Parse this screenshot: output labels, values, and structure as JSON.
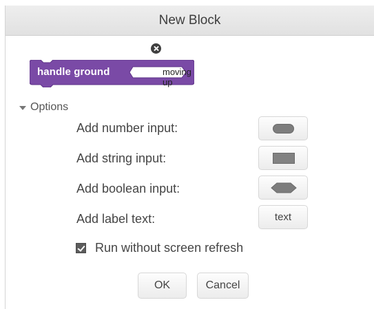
{
  "dialog": {
    "title": "New Block"
  },
  "block": {
    "label": "handle ground",
    "slot_text": "moving up",
    "color": "#7a4aa6",
    "border_color": "#5f3488",
    "delete_icon": "close-circle-icon"
  },
  "options": {
    "toggle_label": "Options",
    "rows": [
      {
        "label": "Add number input:",
        "button_icon": "rounded-pill-icon"
      },
      {
        "label": "Add string input:",
        "button_icon": "rectangle-icon"
      },
      {
        "label": "Add boolean input:",
        "button_icon": "hexagon-icon"
      },
      {
        "label": "Add label text:",
        "button_text": "text"
      }
    ],
    "checkbox": {
      "label": "Run without screen refresh",
      "checked": true
    }
  },
  "buttons": {
    "ok": "OK",
    "cancel": "Cancel"
  }
}
